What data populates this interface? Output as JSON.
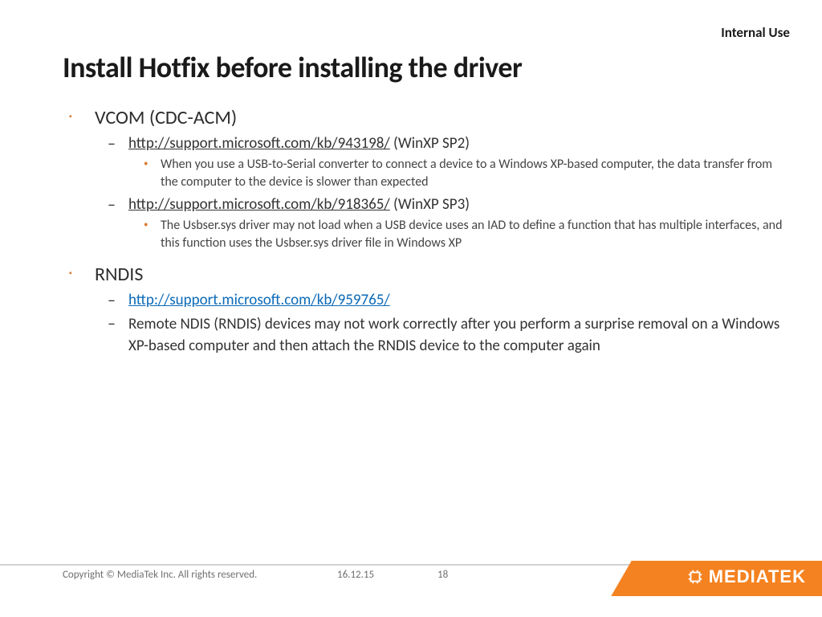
{
  "classification": "Internal Use",
  "title": "Install Hotfix before installing the driver",
  "sections": [
    {
      "heading": "VCOM (CDC-ACM)",
      "items": [
        {
          "link": "http://support.microsoft.com/kb/943198/",
          "suffix": " (WinXP SP2)",
          "link_style": "underline",
          "detail": "When you use a USB-to-Serial converter to connect a device to a Windows XP-based computer, the data transfer from the computer to the device is slower than expected"
        },
        {
          "link": "http://support.microsoft.com/kb/918365/",
          "suffix": " (WinXP SP3)",
          "link_style": "underline",
          "detail": "The Usbser.sys driver may not load when a USB device uses an IAD to define a function that has multiple interfaces, and this function uses the Usbser.sys driver file in Windows XP"
        }
      ]
    },
    {
      "heading": "RNDIS",
      "items": [
        {
          "link": "http://support.microsoft.com/kb/959765/",
          "suffix": "",
          "link_style": "hyperlink",
          "detail": ""
        },
        {
          "link": "",
          "suffix": "",
          "plain": "Remote NDIS (RNDIS) devices may not work correctly after you perform a surprise removal on a Windows XP-based computer and then attach the RNDIS device to the computer again"
        }
      ]
    }
  ],
  "footer": {
    "copyright": "Copyright © MediaTek Inc. All rights reserved.",
    "date": "16.12.15",
    "page": "18"
  },
  "logo": {
    "text": "MEDIATEK"
  }
}
